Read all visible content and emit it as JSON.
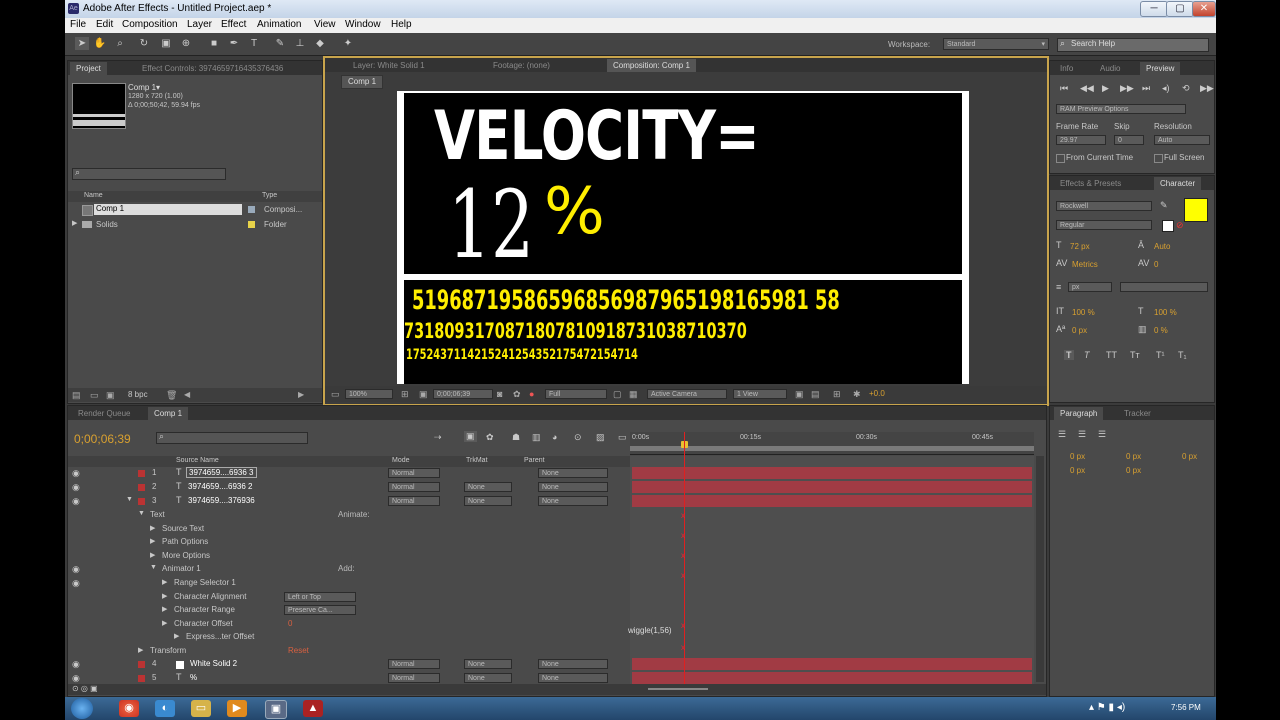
{
  "window": {
    "title": "Adobe After Effects - Untitled Project.aep *",
    "min": "─",
    "max": "▢",
    "close": "✕"
  },
  "menu": [
    "File",
    "Edit",
    "Composition",
    "Layer",
    "Effect",
    "Animation",
    "View",
    "Window",
    "Help"
  ],
  "toolbar": {
    "workspace_label": "Workspace:",
    "workspace_value": "Standard",
    "search_placeholder": "Search Help"
  },
  "project": {
    "tabs": [
      "Project",
      "Effect Controls: 3974659716435376436"
    ],
    "comp_name": "Comp 1▾",
    "comp_info": [
      "1280 x 720 (1.00)",
      "Δ 0;00;50;42, 59.94 fps"
    ],
    "headers": {
      "name": "Name",
      "type": "Type"
    },
    "items": [
      {
        "name": "Comp 1",
        "type": "Composi..."
      },
      {
        "name": "Solids",
        "type": "Folder"
      }
    ],
    "bpc": "8 bpc"
  },
  "viewer": {
    "tabs": [
      "Layer: White Solid 1",
      "Footage: (none)",
      "Composition: Comp 1"
    ],
    "sub_tab": "Comp 1",
    "velocity": "VELOCITY=",
    "percent_number": "12",
    "percent_sign": "%",
    "digits1": "51968719586596856987965198165981 58",
    "digits2": "7318093170871807810918731038710370",
    "digits3": "1752437114215241254352175472154714",
    "zoom": "100%",
    "timecode": "0;00;06;39",
    "resolution": "Full",
    "camera": "Active Camera",
    "view": "1 View",
    "exposure": "+0.0"
  },
  "right": {
    "tabs1": [
      "Info",
      "Audio",
      "Preview"
    ],
    "ram_preview": "RAM Preview Options",
    "frame_rate_label": "Frame Rate",
    "skip_label": "Skip",
    "resolution_label": "Resolution",
    "frame_rate": "29.97",
    "skip": "0",
    "resolution": "Auto",
    "from_current": "From Current Time",
    "full_screen": "Full Screen",
    "tabs2": [
      "Effects & Presets",
      "Character"
    ],
    "font": "Rockwell",
    "style": "Regular",
    "size": "72 px",
    "leading": "Auto",
    "kerning": "Metrics",
    "tracking": "0",
    "unit": "px",
    "v_scale": "100 %",
    "h_scale": "100 %",
    "baseline": "0 px",
    "tsume": "0 %",
    "fill_color": "#ffff00",
    "tabs3": [
      "Paragraph",
      "Tracker"
    ],
    "para_vals": [
      "0 px",
      "0 px",
      "0 px",
      "0 px",
      "0 px"
    ]
  },
  "timeline": {
    "tabs": [
      "Render Queue",
      "Comp 1"
    ],
    "timecode": "0;00;06;39",
    "ruler": [
      "0:00s",
      "00:15s",
      "00:30s",
      "00:45s"
    ],
    "col_headers": {
      "source": "Source Name",
      "mode": "Mode",
      "trkmat": "TrkMat",
      "parent": "Parent"
    },
    "layers": [
      {
        "num": "1",
        "name": "3974659....6936 3",
        "mode": "Normal",
        "trk": "",
        "parent": "None"
      },
      {
        "num": "2",
        "name": "3974659....6936 2",
        "mode": "Normal",
        "trk": "None",
        "parent": "None"
      },
      {
        "num": "3",
        "name": "3974659....376936",
        "mode": "Normal",
        "trk": "None",
        "parent": "None"
      }
    ],
    "props": [
      {
        "label": "Text",
        "indent": 0,
        "right": "Animate:"
      },
      {
        "label": "Source Text",
        "indent": 1,
        "right": ""
      },
      {
        "label": "Path Options",
        "indent": 1,
        "right": ""
      },
      {
        "label": "More Options",
        "indent": 1,
        "right": ""
      },
      {
        "label": "Animator 1",
        "indent": 1,
        "right": "Add:"
      },
      {
        "label": "Range Selector 1",
        "indent": 2,
        "right": ""
      },
      {
        "label": "Character Alignment",
        "indent": 2,
        "right": "Left or Top"
      },
      {
        "label": "Character Range",
        "indent": 2,
        "right": "Preserve Ca..."
      },
      {
        "label": "Character Offset",
        "indent": 2,
        "right": "0"
      },
      {
        "label": "Express...ter Offset",
        "indent": 3,
        "right": ""
      },
      {
        "label": "Transform",
        "indent": 0,
        "right": "Reset"
      }
    ],
    "expression": "wiggle(1,56)",
    "layers2": [
      {
        "num": "4",
        "name": "White Solid 2",
        "mode": "Normal",
        "trk": "None",
        "parent": "None"
      },
      {
        "num": "5",
        "name": "%",
        "mode": "Normal",
        "trk": "None",
        "parent": "None"
      }
    ]
  },
  "taskbar": {
    "clock": "7:56 PM"
  }
}
